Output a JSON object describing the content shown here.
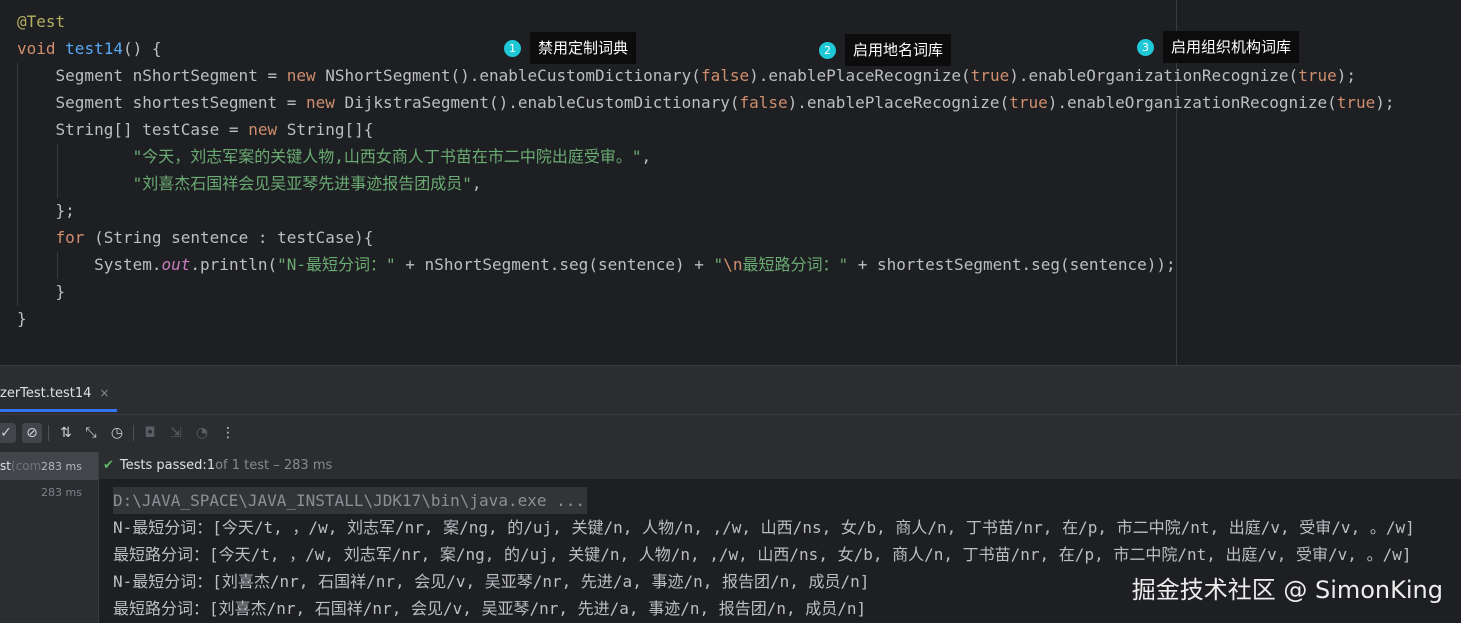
{
  "editor": {
    "lines": [
      "@Test",
      "void test14() {",
      "    Segment nShortSegment = new NShortSegment().enableCustomDictionary(false).enablePlaceRecognize(true).enableOrganizationRecognize(true);",
      "    Segment shortestSegment = new DijkstraSegment().enableCustomDictionary(false).enablePlaceRecognize(true).enableOrganizationRecognize(true);",
      "    String[] testCase = new String[]{",
      "            \"今天，刘志军案的关键人物,山西女商人丁书苗在市二中院出庭受审。\",",
      "            \"刘喜杰石国祥会见吴亚琴先进事迹报告团成员\",",
      "    };",
      "    for (String sentence : testCase){",
      "        System.out.println(\"N-最短分词：\" + nShortSegment.seg(sentence) + \"\\n最短路分词：\" + shortestSegment.seg(sentence));",
      "    }",
      "}"
    ]
  },
  "callouts": [
    {
      "num": "1",
      "label": "禁用定制词典"
    },
    {
      "num": "2",
      "label": "启用地名词库"
    },
    {
      "num": "3",
      "label": "启用组织机构词库"
    }
  ],
  "run_panel": {
    "tab_label": "zerTest.test14",
    "tab_close": "×",
    "tree": [
      {
        "name": "st",
        "sub": " (com",
        "ms": "283 ms"
      },
      {
        "name": "",
        "sub": "",
        "ms": "283 ms"
      }
    ],
    "status": {
      "prefix": "Tests passed: ",
      "count": "1",
      "suffix": " of 1 test – 283 ms"
    },
    "console": [
      "D:\\JAVA_SPACE\\JAVA_INSTALL\\JDK17\\bin\\java.exe ...",
      "N-最短分词：[今天/t, ，/w, 刘志军/nr, 案/ng, 的/uj, 关键/n, 人物/n, ,/w, 山西/ns, 女/b, 商人/n, 丁书苗/nr, 在/p, 市二中院/nt, 出庭/v, 受审/v, 。/w]",
      "最短路分词：[今天/t, ，/w, 刘志军/nr, 案/ng, 的/uj, 关键/n, 人物/n, ,/w, 山西/ns, 女/b, 商人/n, 丁书苗/nr, 在/p, 市二中院/nt, 出庭/v, 受审/v, 。/w]",
      "N-最短分词：[刘喜杰/nr, 石国祥/nr, 会见/v, 吴亚琴/nr, 先进/a, 事迹/n, 报告团/n, 成员/n]",
      "最短路分词：[刘喜杰/nr, 石国祥/nr, 会见/v, 吴亚琴/nr, 先进/a, 事迹/n, 报告团/n, 成员/n]"
    ]
  },
  "toolbar_icons": [
    "check-icon",
    "stop-circle-icon",
    "sort-icon",
    "collapse-icon",
    "clock-icon",
    "camera-icon",
    "import-icon",
    "history-icon",
    "more-vertical-icon"
  ],
  "watermark": "掘金技术社区 @ SimonKing",
  "colors": {
    "background": "#1e1f22",
    "panel": "#2b2d30",
    "keyword": "#cf8e6d",
    "function": "#56a8f5",
    "string": "#6aab73",
    "annotation": "#b3ae60",
    "static_field": "#c77dbb",
    "callout_badge": "#1ec8d6",
    "pass_green": "#5fb865",
    "tab_underline": "#3574f0"
  }
}
